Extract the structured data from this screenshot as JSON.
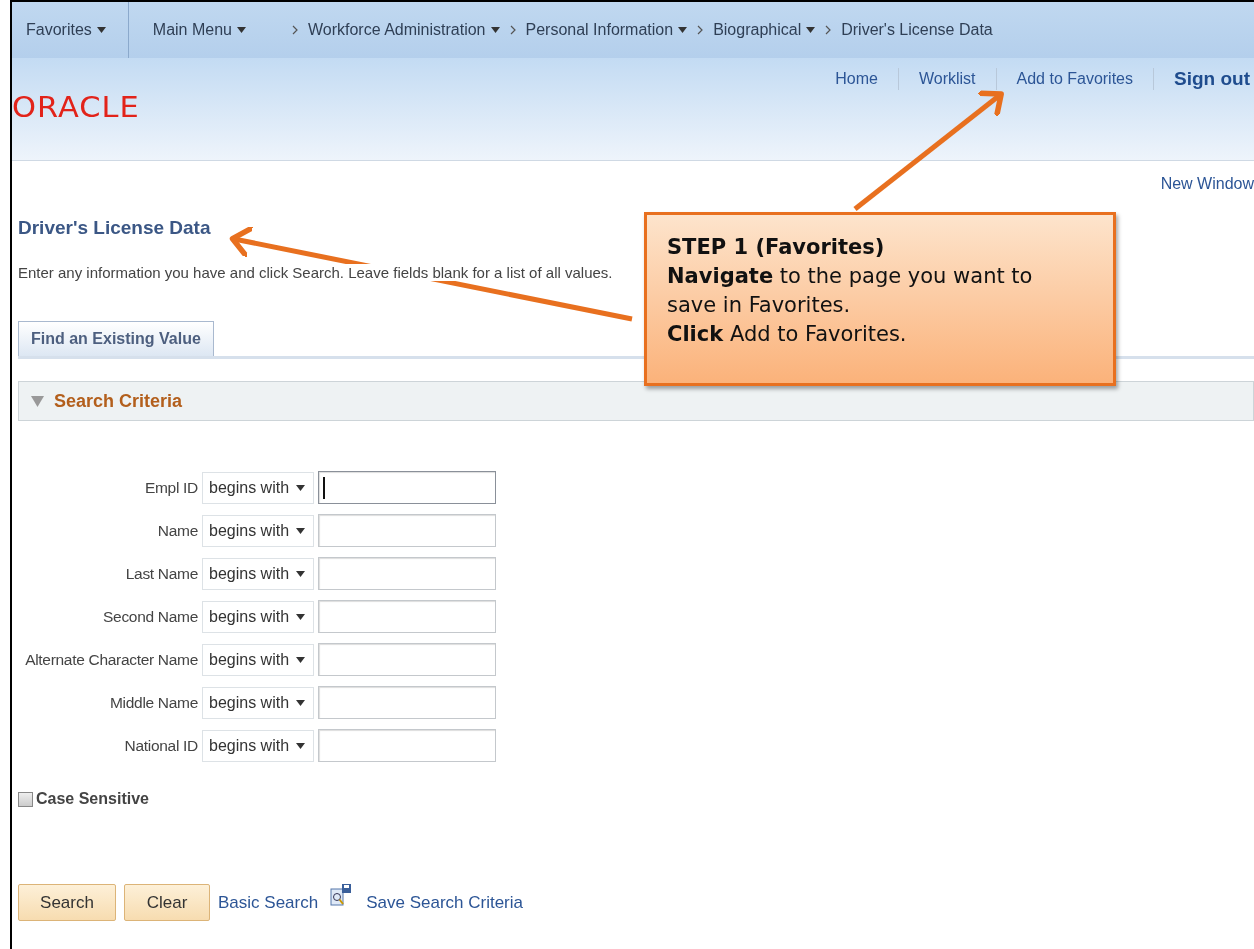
{
  "breadcrumbs": [
    {
      "label": "Favorites",
      "menu": true,
      "kind": "root"
    },
    {
      "label": "Main Menu",
      "menu": true,
      "kind": "root"
    },
    {
      "label": "Workforce Administration",
      "menu": true,
      "kind": "crumb"
    },
    {
      "label": "Personal Information",
      "menu": true,
      "kind": "crumb"
    },
    {
      "label": "Biographical",
      "menu": true,
      "kind": "crumb"
    },
    {
      "label": "Driver's License Data",
      "menu": false,
      "kind": "crumb"
    }
  ],
  "logo": "ORACLE",
  "header_links": [
    {
      "label": "Home",
      "kind": "link"
    },
    {
      "label": "Worklist",
      "kind": "link"
    },
    {
      "label": "Add to Favorites",
      "kind": "link"
    },
    {
      "label": "Sign out",
      "kind": "strong"
    }
  ],
  "new_window": "New Window",
  "page_title": "Driver's License Data",
  "instructions": "Enter any information you have and click Search. Leave fields blank for a list of all values.",
  "tabs": [
    {
      "label": "Find an Existing Value",
      "selected": true
    }
  ],
  "section": {
    "title": "Search Criteria",
    "expanded": true
  },
  "criteria": [
    {
      "label": "Empl ID",
      "operator": "begins with",
      "focused": true
    },
    {
      "label": "Name",
      "operator": "begins with",
      "focused": false
    },
    {
      "label": "Last Name",
      "operator": "begins with",
      "focused": false
    },
    {
      "label": "Second Name",
      "operator": "begins with",
      "focused": false
    },
    {
      "label": "Alternate Character Name",
      "operator": "begins with",
      "focused": false
    },
    {
      "label": "Middle Name",
      "operator": "begins with",
      "focused": false
    },
    {
      "label": "National ID",
      "operator": "begins with",
      "focused": false
    }
  ],
  "case_sensitive": {
    "label": "Case Sensitive",
    "checked": false
  },
  "buttons": [
    "Search",
    "Clear"
  ],
  "basic_search": "Basic Search",
  "save_criteria": "Save Search Criteria",
  "callout": {
    "title": "STEP 1 (Favorites)",
    "lines": [
      "**Navigate** to the page you want to save in Favorites.",
      "**Click** Add to Favorites."
    ]
  }
}
